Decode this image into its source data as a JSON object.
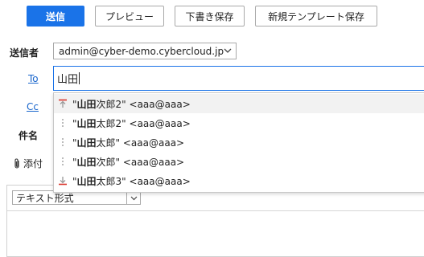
{
  "toolbar": {
    "send_label": "送信",
    "preview_label": "プレビュー",
    "save_draft_label": "下書き保存",
    "save_template_label": "新規テンプレート保存",
    "send_color": "#1a73e8"
  },
  "form": {
    "sender_label": "送信者",
    "sender_value": "admin@cyber-demo.cybercloud.jp",
    "to_label": "To",
    "to_value": "山田",
    "cc_label": "Cc",
    "subject_label": "件名",
    "attach_label": "添付"
  },
  "suggestions": [
    {
      "icon": "move-top-icon",
      "prefix": "\"",
      "match": "山田",
      "rest": "次郎2\" <aaa@aaa>"
    },
    {
      "icon": "drag-handle-icon",
      "prefix": "\"",
      "match": "山田",
      "rest": "太郎2\" <aaa@aaa>"
    },
    {
      "icon": "drag-handle-icon",
      "prefix": "\"",
      "match": "山田",
      "rest": "太郎\" <aaa@aaa>"
    },
    {
      "icon": "drag-handle-icon",
      "prefix": "\"",
      "match": "山田",
      "rest": "次郎\" <aaa@aaa>"
    },
    {
      "icon": "move-bottom-icon",
      "prefix": "\"",
      "match": "山田",
      "rest": "太郎3\" <aaa@aaa>"
    }
  ],
  "editor": {
    "format_value": "テキスト形式"
  }
}
